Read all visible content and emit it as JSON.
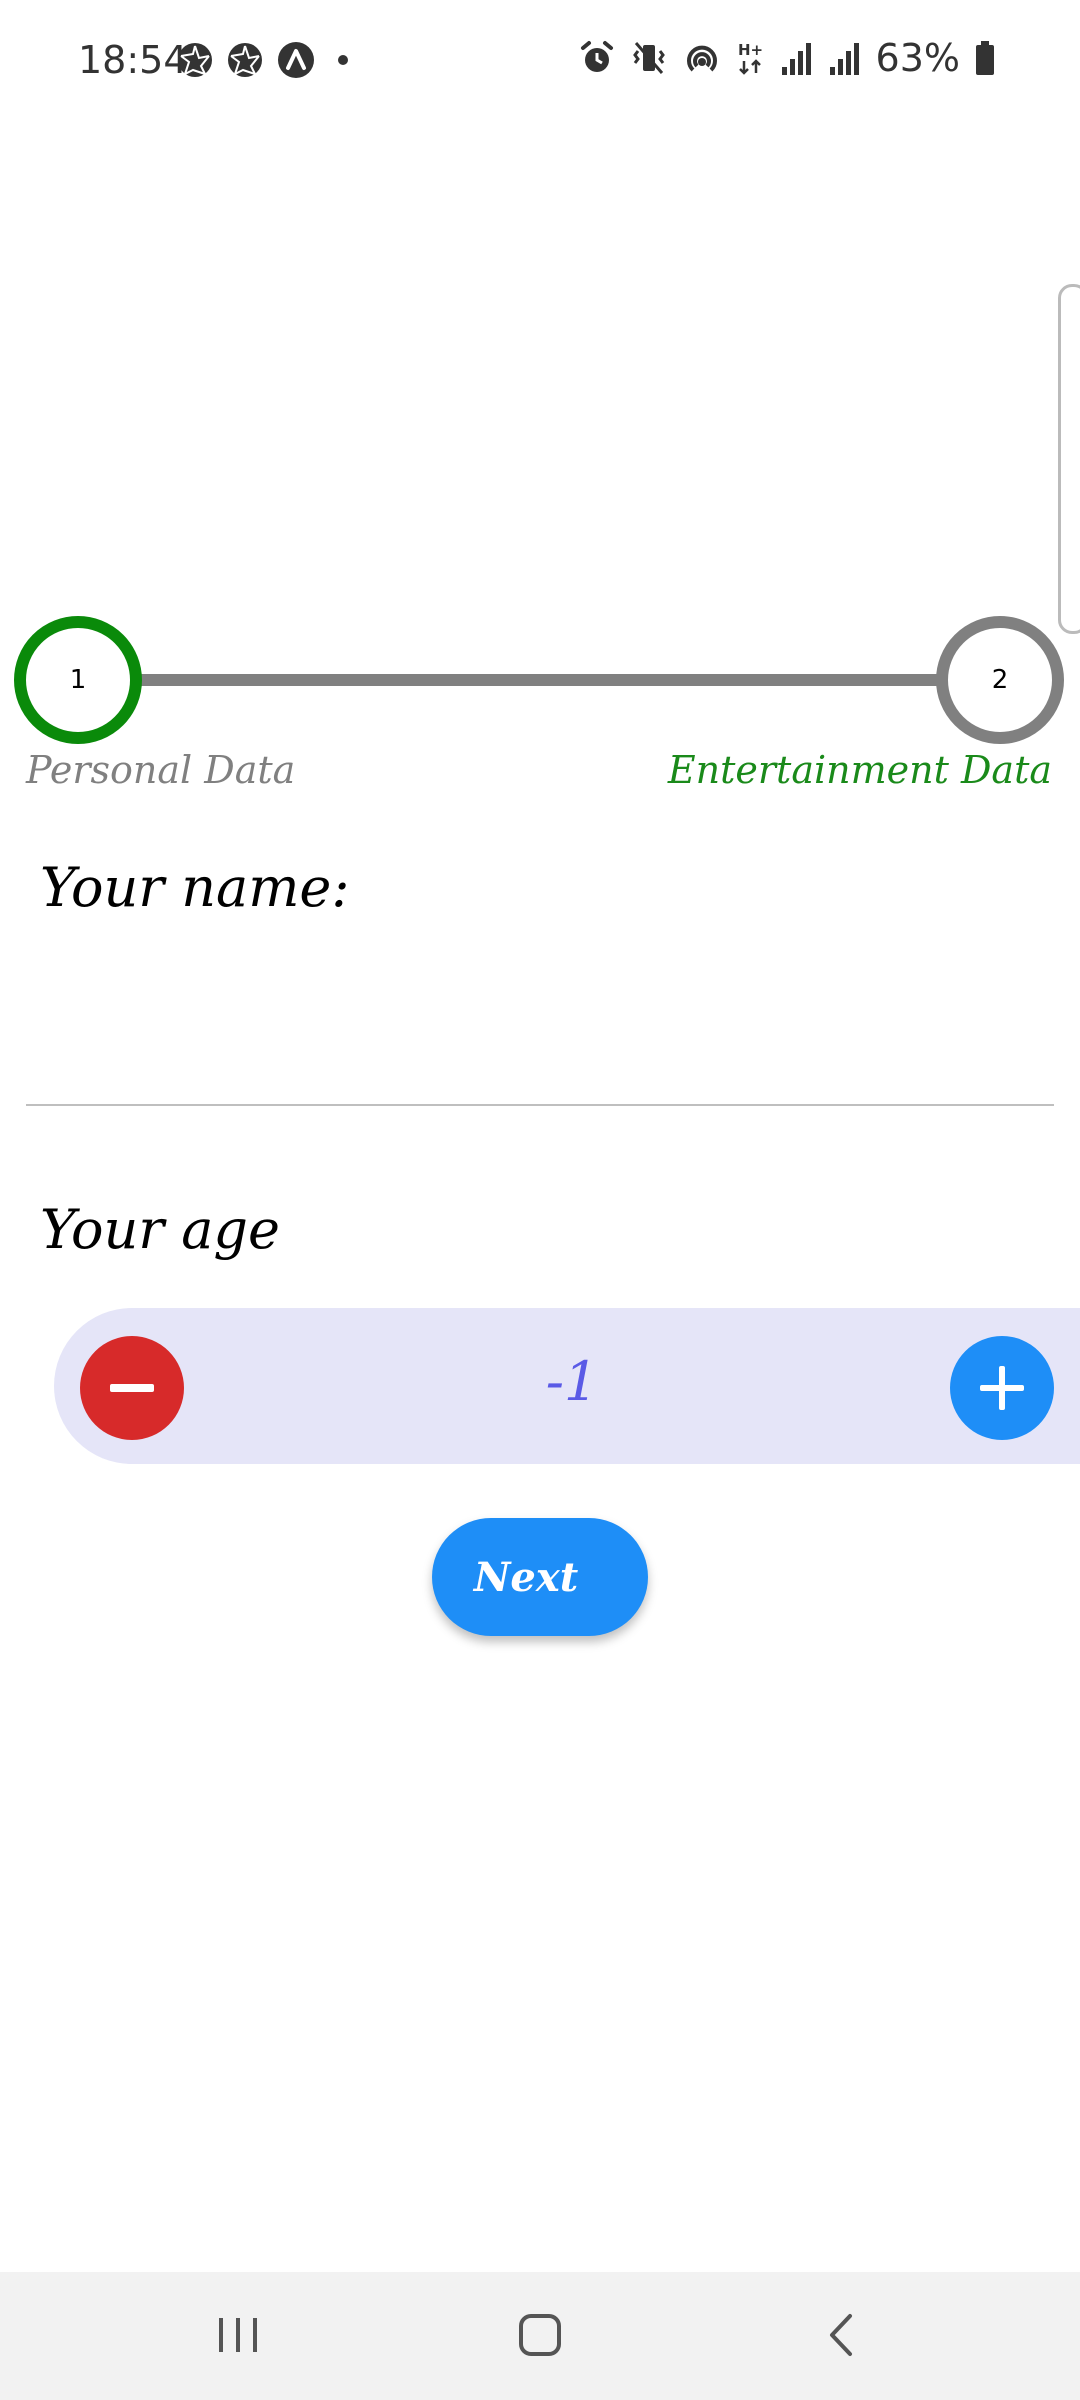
{
  "status_bar": {
    "time": "18:54",
    "battery": "63%",
    "left_icons": [
      "aperture-icon",
      "aperture-icon",
      "app-a-icon",
      "dot-icon"
    ],
    "right_icons": [
      "alarm-icon",
      "vibrate-icon",
      "hotspot-icon",
      "hplus-icon",
      "signal-icon",
      "signal-icon",
      "battery-icon"
    ]
  },
  "stepper": {
    "step1": {
      "number": "1",
      "label": "Personal Data",
      "color": "#0a8a0a"
    },
    "step2": {
      "number": "2",
      "label": "Entertainment Data",
      "color": "#808080"
    },
    "line_color": "#808080"
  },
  "form": {
    "name_label": "Your name:",
    "name_value": "",
    "age_label": "Your age",
    "age_value": "-1"
  },
  "actions": {
    "next_label": "Next"
  },
  "colors": {
    "accent_blue": "#1e8ef7",
    "minus_red": "#d72a2a",
    "age_bg": "#e5e5f8",
    "age_text": "#5a5ae6",
    "active_green": "#0a8a0a"
  },
  "nav": {
    "icons": [
      "recents-icon",
      "home-icon",
      "back-icon"
    ]
  }
}
